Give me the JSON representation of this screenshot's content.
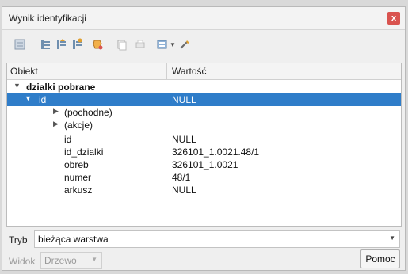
{
  "window": {
    "title": "Wynik identyfikacji",
    "close_label": "x"
  },
  "toolbar": {
    "icons": [
      "expand-tree-icon",
      "collapse-tree-icon",
      "expand-all-icon",
      "collapse-all-icon",
      "highlight-icon",
      "copy-icon",
      "print-icon",
      "identify-options-icon",
      "dropdown-arrow-icon",
      "pick-icon"
    ]
  },
  "tree": {
    "headers": {
      "object": "Obiekt",
      "value": "Wartość"
    },
    "layer": {
      "label": "dzialki pobrane"
    },
    "selected": {
      "key": "id",
      "value": "NULL"
    },
    "groups": [
      {
        "label": "(pochodne)"
      },
      {
        "label": "(akcje)"
      }
    ],
    "attributes": [
      {
        "key": "id",
        "value": "NULL"
      },
      {
        "key": "id_dzialki",
        "value": "326101_1.0021.48/1"
      },
      {
        "key": "obreb",
        "value": "326101_1.0021"
      },
      {
        "key": "numer",
        "value": "48/1"
      },
      {
        "key": "arkusz",
        "value": "NULL"
      }
    ]
  },
  "mode": {
    "label": "Tryb",
    "value": "bieżąca warstwa"
  },
  "view": {
    "label": "Widok",
    "value": "Drzewo"
  },
  "help_button": {
    "label": "Pomoc"
  }
}
